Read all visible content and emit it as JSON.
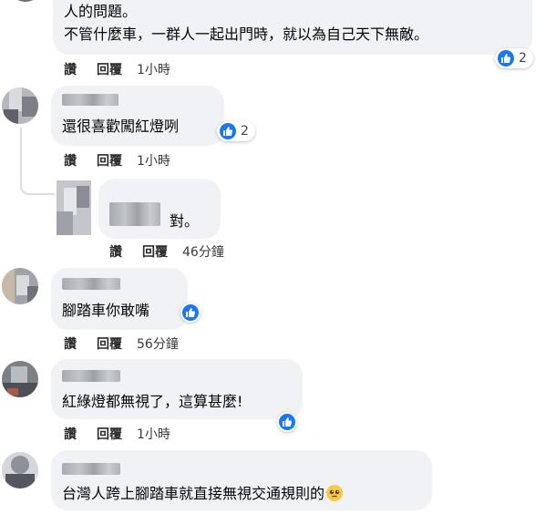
{
  "actions": {
    "like": "讚",
    "reply": "回覆"
  },
  "comments": [
    {
      "lines": [
        "人的問題。",
        "不管什麼車，一群人一起出門時，就以為自己天下無敵。"
      ],
      "time": "1小時",
      "likes": "2"
    },
    {
      "text": "還很喜歡闖紅燈咧",
      "time": "1小時",
      "likes": "2"
    },
    {
      "text": "對。",
      "time": "46分鐘"
    },
    {
      "text": "腳踏車你敢嘴",
      "time": "56分鐘"
    },
    {
      "text": "紅綠燈都無視了，這算甚麼!",
      "time": "1小時"
    },
    {
      "text": "台灣人跨上腳踏車就直接無視交通規則的"
    }
  ],
  "colors": {
    "bubble": "#f0f2f5",
    "like_blue": "#1877f2"
  },
  "icons": {
    "reaction": "like-icon",
    "emoji": "pleading-face-icon"
  }
}
